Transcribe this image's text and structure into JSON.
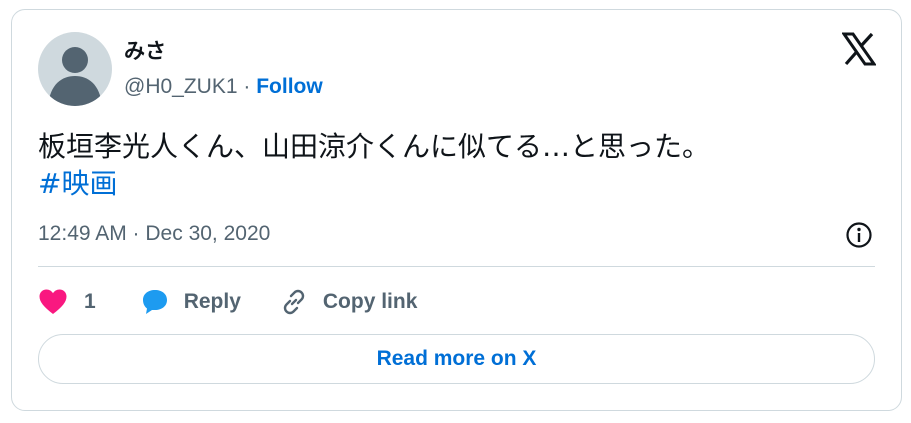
{
  "author": {
    "name": "みさ",
    "handle": "@H0_ZUK1",
    "separator": "·",
    "follow_label": "Follow"
  },
  "tweet": {
    "text": "板垣李光人くん、山田涼介くんに似てる…と思った。",
    "hashtag": "#映画",
    "timestamp": "12:49 AM · Dec 30, 2020"
  },
  "actions": {
    "like_count": "1",
    "reply_label": "Reply",
    "copy_link_label": "Copy link"
  },
  "read_more_label": "Read more on X",
  "icons": {
    "logo": "x-logo-icon",
    "info": "info-icon",
    "like": "heart-icon",
    "reply": "speech-bubble-icon",
    "copy": "link-icon"
  },
  "colors": {
    "link": "#006fd6",
    "like": "#f91880",
    "reply": "#1d9bf0",
    "secondary_text": "#536471",
    "border": "#cfd9de"
  }
}
